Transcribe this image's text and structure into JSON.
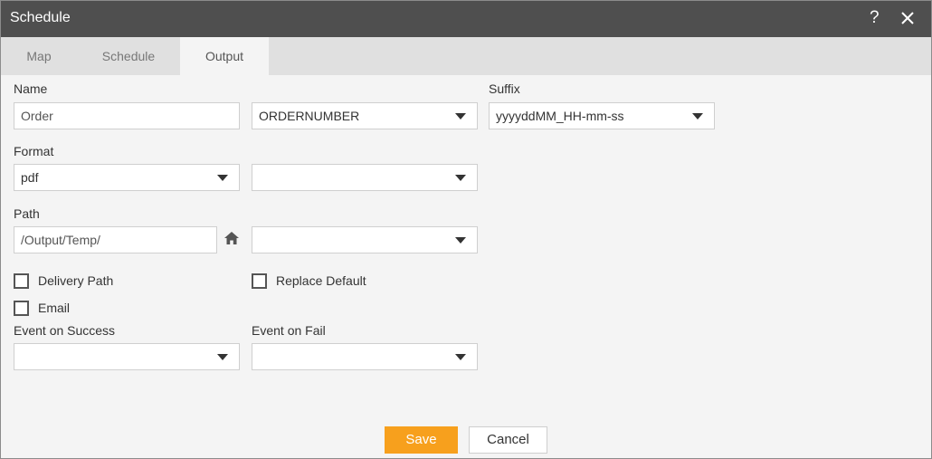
{
  "dialog": {
    "title": "Schedule",
    "help_glyph": "?",
    "icons": {
      "help": "help-icon",
      "close": "close-icon",
      "home": "home-icon",
      "dropdown": "chevron-down-icon"
    }
  },
  "tabs": [
    {
      "label": "Map",
      "active": false
    },
    {
      "label": "Schedule",
      "active": false
    },
    {
      "label": "Output",
      "active": true
    }
  ],
  "name": {
    "label": "Name",
    "value": "Order",
    "variable_select": "ORDERNUMBER"
  },
  "suffix": {
    "label": "Suffix",
    "value": "yyyyddMM_HH-mm-ss"
  },
  "format": {
    "label": "Format",
    "value": "pdf",
    "secondary_select": ""
  },
  "path": {
    "label": "Path",
    "value": "/Output/Temp/",
    "secondary_select": ""
  },
  "checkboxes": {
    "delivery_path": {
      "label": "Delivery Path",
      "checked": false
    },
    "replace_default": {
      "label": "Replace Default",
      "checked": false
    },
    "email": {
      "label": "Email",
      "checked": false
    }
  },
  "events": {
    "success_label": "Event on Success",
    "success_value": "",
    "fail_label": "Event on Fail",
    "fail_value": ""
  },
  "buttons": {
    "save": "Save",
    "cancel": "Cancel"
  },
  "colors": {
    "titlebar": "#4f4f4f",
    "tabbar": "#e0e0e0",
    "body": "#f4f4f4",
    "accent": "#f7a01d"
  }
}
